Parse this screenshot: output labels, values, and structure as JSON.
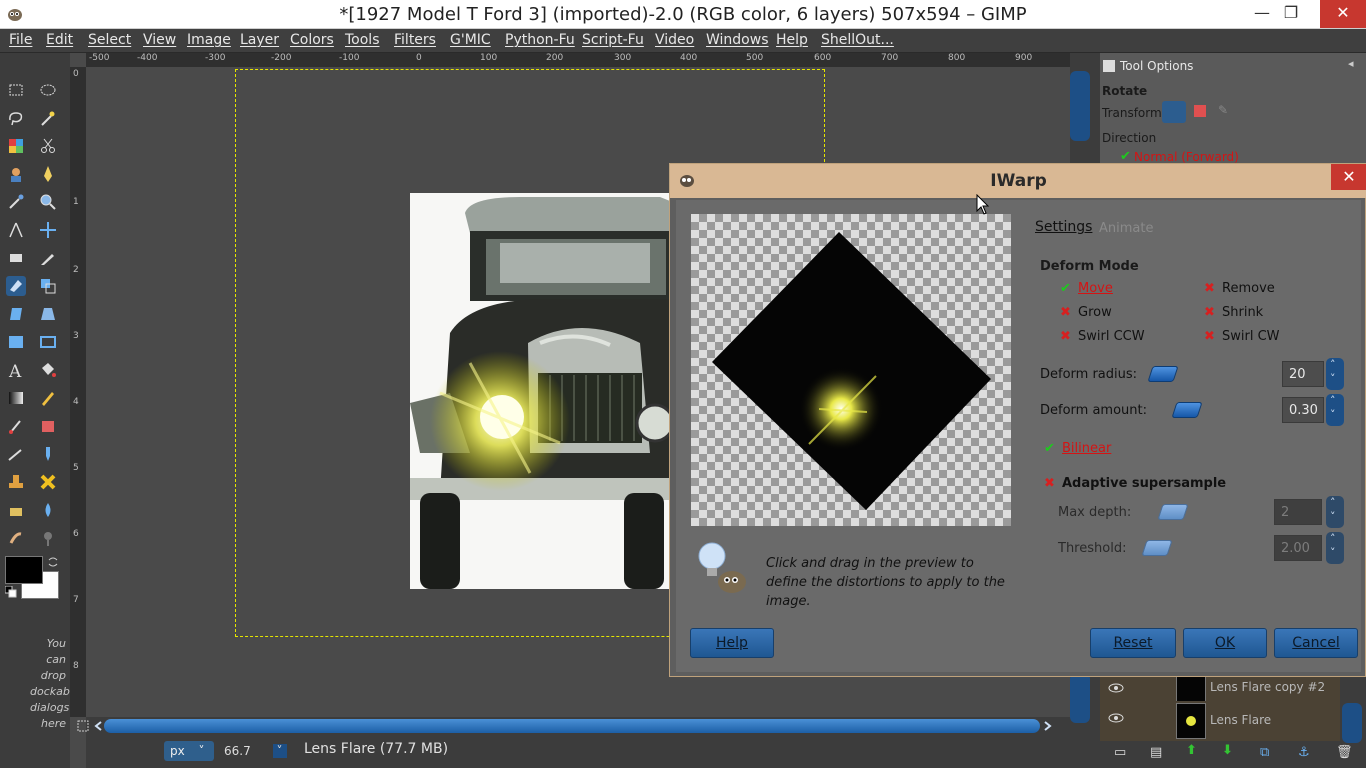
{
  "window": {
    "title": "*[1927 Model T Ford 3] (imported)-2.0 (RGB color, 6 layers) 507x594 – GIMP",
    "minimize": "—",
    "maximize": "❐",
    "close": "✕"
  },
  "menu": [
    "File",
    "Edit",
    "Select",
    "View",
    "Image",
    "Layer",
    "Colors",
    "Tools",
    "Filters",
    "G'MIC",
    "Python-Fu",
    "Script-Fu",
    "Video",
    "Windows",
    "Help",
    "ShellOut..."
  ],
  "toolbox": {
    "dock_hint": "You can drop dockable dialogs here"
  },
  "ruler_top": [
    "-500",
    "-400",
    "-300",
    "-200",
    "-100",
    "0",
    "100",
    "200",
    "300",
    "400",
    "500",
    "600",
    "700",
    "800",
    "900"
  ],
  "ruler_left": [
    "0",
    "1",
    "2",
    "3",
    "4",
    "5",
    "6",
    "7",
    "8"
  ],
  "status": {
    "unit": "px",
    "zoom": "66.7",
    "message": "Lens Flare (77.7 MB)"
  },
  "tool_options": {
    "header": "Tool Options",
    "tool": "Rotate",
    "transform_label": "Transform:",
    "direction_label": "Direction",
    "direction_value": "Normal (Forward)"
  },
  "layers": [
    {
      "name": "Lens Flare copy #2"
    },
    {
      "name": "Lens Flare"
    }
  ],
  "iwarp": {
    "title": "IWarp",
    "close": "✕",
    "tabs": {
      "settings": "Settings",
      "animate": "Animate"
    },
    "deform_mode_label": "Deform Mode",
    "modes": {
      "move": "Move",
      "remove": "Remove",
      "grow": "Grow",
      "shrink": "Shrink",
      "swirl_ccw": "Swirl CCW",
      "swirl_cw": "Swirl CW"
    },
    "deform_radius_label": "Deform radius:",
    "deform_radius_value": "20",
    "deform_amount_label": "Deform amount:",
    "deform_amount_value": "0.30",
    "bilinear_label": "Bilinear",
    "adaptive_label": "Adaptive supersample",
    "max_depth_label": "Max depth:",
    "max_depth_value": "2",
    "threshold_label": "Threshold:",
    "threshold_value": "2.00",
    "hint": "Click and drag in the preview to define the distortions to apply to the image.",
    "buttons": {
      "help": "Help",
      "reset": "Reset",
      "ok": "OK",
      "cancel": "Cancel"
    }
  },
  "colors": {
    "accent_blue": "#1d4f86",
    "dialog_title": "#d9b894",
    "checked_green": "#1fc81f",
    "unchecked_red": "#d62020",
    "selection_dash": "#e6e600"
  }
}
